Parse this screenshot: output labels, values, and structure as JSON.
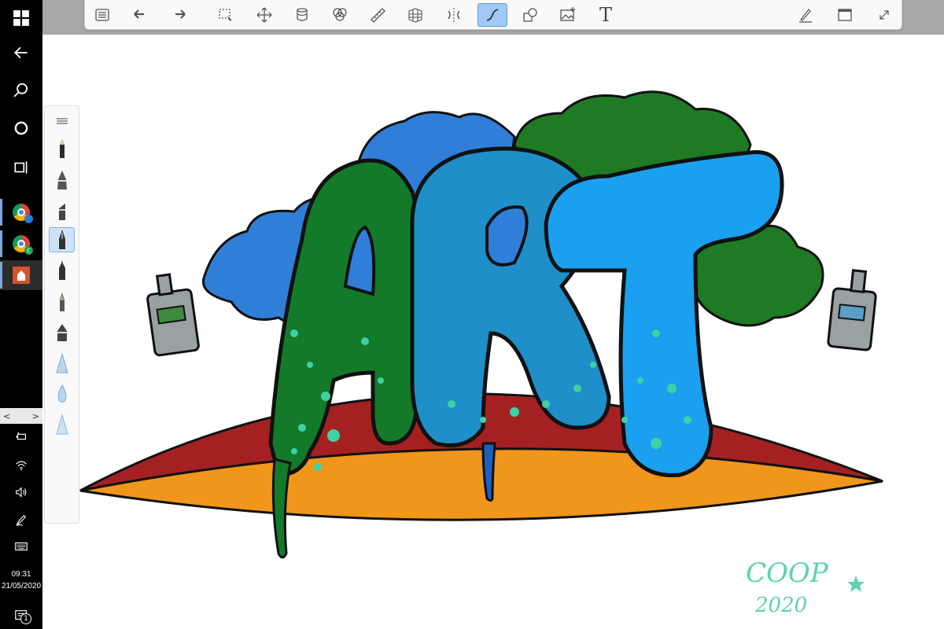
{
  "taskbar": {
    "start_icon": "windows-logo-icon",
    "back_icon": "back-arrow-icon",
    "search_icon": "search-icon",
    "cortana_icon": "cortana-circle-icon",
    "task_view_icon": "task-view-icon",
    "apps": [
      {
        "name": "chrome-icon",
        "badge_color": "#2d7bd6",
        "badge": "",
        "active": false
      },
      {
        "name": "chrome-icon",
        "badge_color": "#17a05e",
        "badge": "C",
        "active": false
      },
      {
        "name": "sketchable-icon",
        "active": true
      }
    ],
    "tray_scroll_left": "<",
    "tray_scroll_right": ">",
    "tray": [
      "battery-icon",
      "wifi-icon",
      "volume-icon",
      "pen-icon",
      "keyboard-icon"
    ],
    "clock_time": "09:31",
    "clock_date": "21/05/2020",
    "notification_count": "1"
  },
  "toolbar": {
    "tools": [
      {
        "name": "menu-list-icon"
      },
      {
        "name": "undo-icon"
      },
      {
        "name": "redo-icon"
      },
      {
        "name": "selection-icon"
      },
      {
        "name": "move-icon"
      },
      {
        "name": "layers-icon"
      },
      {
        "name": "color-mixer-icon"
      },
      {
        "name": "ruler-icon"
      },
      {
        "name": "perspective-grid-icon"
      },
      {
        "name": "symmetry-icon"
      },
      {
        "name": "curve-stroke-icon",
        "selected": true
      },
      {
        "name": "shapes-icon"
      },
      {
        "name": "insert-image-icon"
      },
      {
        "name": "text-tool-icon",
        "glyph": "T"
      },
      {
        "name": "pen-settings-icon"
      },
      {
        "name": "window-mode-icon"
      },
      {
        "name": "fullscreen-icon"
      }
    ]
  },
  "brushes": [
    {
      "name": "brush-palette-toggle-icon"
    },
    {
      "name": "pencil-brush-icon"
    },
    {
      "name": "ink-pen-brush-icon"
    },
    {
      "name": "marker-brush-icon"
    },
    {
      "name": "fountain-pen-brush-icon",
      "selected": true
    },
    {
      "name": "technical-pen-brush-icon"
    },
    {
      "name": "paint-brush-icon"
    },
    {
      "name": "chisel-marker-brush-icon"
    },
    {
      "name": "cone-airbrush-icon"
    },
    {
      "name": "drop-blender-icon"
    },
    {
      "name": "cone-eraser-icon"
    }
  ],
  "artwork": {
    "letters": "ART",
    "signature_line1": "COOP",
    "signature_line2": "2020",
    "colors": {
      "blue_cloud": "#2f7fd8",
      "green_cloud": "#1f7a24",
      "red_surf": "#a52121",
      "orange_surf": "#f0961a",
      "letter_a": "#137a2a",
      "letter_t": "#1aa0ee",
      "spray_can": "#9aa1a3",
      "signature": "#5cd2b0"
    }
  }
}
